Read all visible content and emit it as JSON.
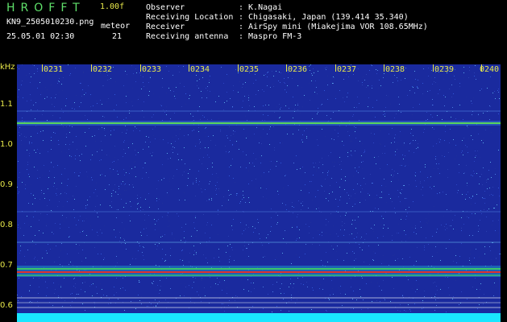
{
  "header": {
    "logo": "HROFFT",
    "version": "1.00f",
    "filename": "KN9_2505010230.png",
    "datetime": "25.05.01 02:30",
    "meteor_label": "meteor",
    "meteor_count": "21",
    "fields": [
      {
        "label": "Observer",
        "value": ": K.Nagai"
      },
      {
        "label": "Receiving Location",
        "value": ": Chigasaki, Japan (139.414 35.340)"
      },
      {
        "label": "Receiver",
        "value": ": AirSpy mini (Miakejima VOR 108.65MHz)"
      },
      {
        "label": "Receiving antenna",
        "value": ": Maspro FM-3"
      }
    ]
  },
  "axis": {
    "unit": "kHz",
    "y_ticks": [
      "1.1",
      "1.0",
      "0.9",
      "0.8",
      "0.7",
      "0.6"
    ],
    "x_ticks": [
      "0231",
      "0232",
      "0233",
      "0234",
      "0235",
      "0236",
      "0237",
      "0238",
      "0239",
      "0240"
    ]
  },
  "colors": {
    "background": "#1a2a9e",
    "label": "#e8e84a",
    "band_line": "#e03030",
    "strong_line": "#40d060",
    "bottom_strip": "#19e6ff"
  }
}
